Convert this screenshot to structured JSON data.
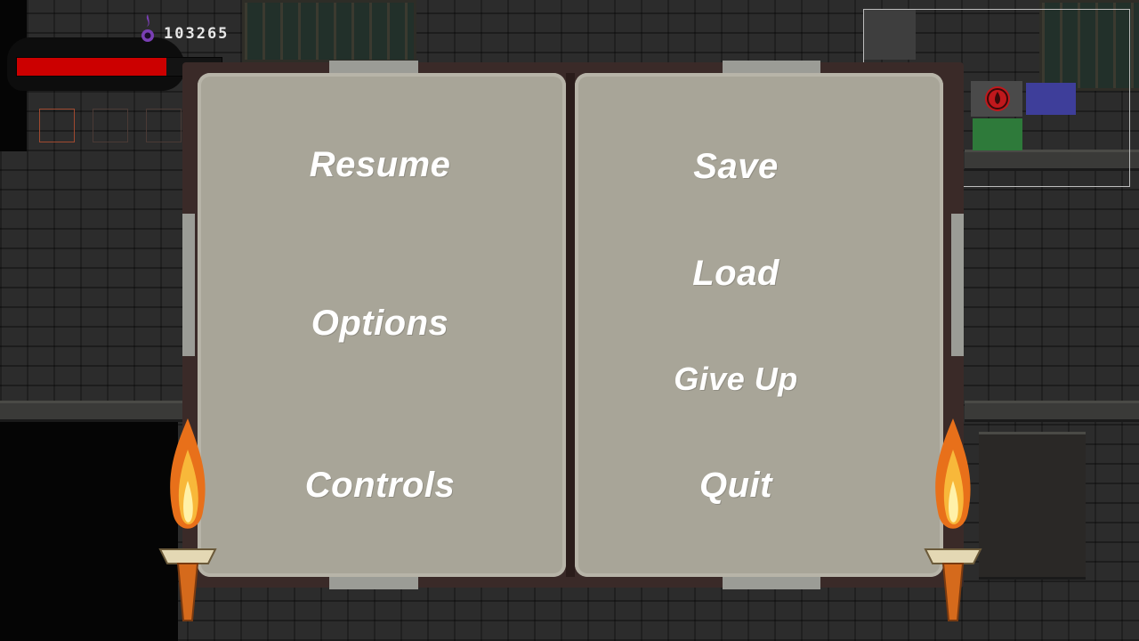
{
  "hud": {
    "soul_count": "103265",
    "health_fraction": 0.73,
    "colors": {
      "health": "#cc0000",
      "soul": "#7a3fb5"
    }
  },
  "pause_menu": {
    "left_page": {
      "resume": "Resume",
      "options": "Options",
      "controls": "Controls"
    },
    "right_page": {
      "save": "Save",
      "load": "Load",
      "give_up": "Give Up",
      "quit": "Quit"
    }
  },
  "icons": {
    "soul": "soul-flame-icon",
    "blood": "blood-drop-icon",
    "torch": "torch-icon"
  }
}
